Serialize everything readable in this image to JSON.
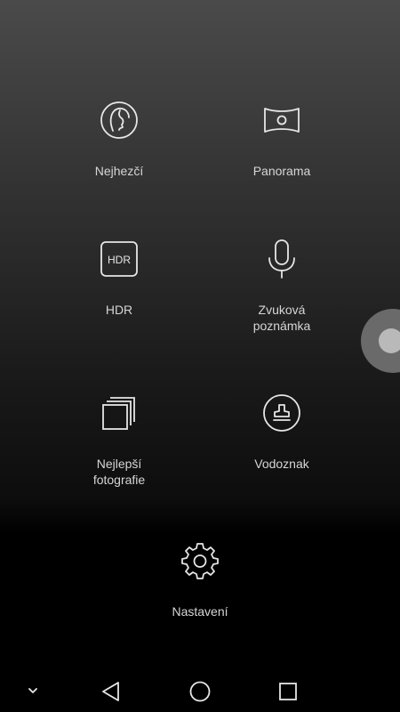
{
  "modes": {
    "beauty": {
      "label": "Nejhezčí",
      "icon": "face-profile-icon"
    },
    "panorama": {
      "label": "Panorama",
      "icon": "panorama-icon"
    },
    "hdr": {
      "label": "HDR",
      "icon": "hdr-icon",
      "icon_text": "HDR"
    },
    "audio_note": {
      "label": "Zvuková\npoznámka",
      "icon": "microphone-icon"
    },
    "best_photo": {
      "label": "Nejlepší\nfotografie",
      "icon": "stacked-photos-icon"
    },
    "watermark": {
      "label": "Vodoznak",
      "icon": "stamp-icon"
    }
  },
  "settings": {
    "label": "Nastavení",
    "icon": "gear-icon"
  },
  "navbar": {
    "icons": [
      "chevron-down-icon",
      "back-triangle-icon",
      "home-circle-icon",
      "recents-square-icon"
    ]
  },
  "colors": {
    "label": "#d6d6d6",
    "icon_stroke": "#e6e6e6",
    "handle_outer": "#6a6a6a",
    "handle_inner": "#b9b9b9"
  }
}
